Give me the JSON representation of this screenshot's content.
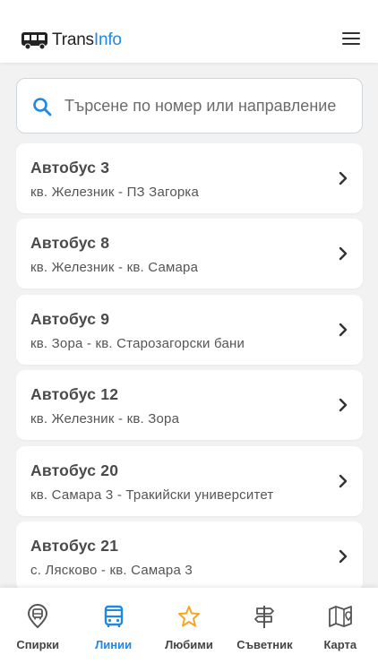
{
  "header": {
    "logo_part1": "Trans",
    "logo_part2": "Info",
    "logo_icon": "bus-icon",
    "menu_icon": "hamburger-menu-icon"
  },
  "search": {
    "placeholder": "Търсене по номер или направление",
    "value": "",
    "icon": "search-icon"
  },
  "lines": [
    {
      "title": "Автобус 3",
      "route": "кв. Железник - ПЗ Загорка"
    },
    {
      "title": "Автобус 8",
      "route": "кв. Железник - кв. Самара"
    },
    {
      "title": "Автобус 9",
      "route": "кв. Зора - кв. Старозагорски бани"
    },
    {
      "title": "Автобус 12",
      "route": "кв. Железник - кв. Зора"
    },
    {
      "title": "Автобус 20",
      "route": "кв. Самара 3 - Тракийски университет"
    },
    {
      "title": "Автобус 21",
      "route": "с. Лясково - кв. Самара 3"
    }
  ],
  "nav": {
    "active": "lines",
    "items": [
      {
        "id": "stops",
        "label": "Спирки",
        "icon": "bus-stop-icon"
      },
      {
        "id": "lines",
        "label": "Линии",
        "icon": "bus-icon"
      },
      {
        "id": "favorites",
        "label": "Любими",
        "icon": "star-icon"
      },
      {
        "id": "advisor",
        "label": "Съветник",
        "icon": "signpost-icon"
      },
      {
        "id": "map",
        "label": "Карта",
        "icon": "map-icon"
      }
    ]
  },
  "colors": {
    "accent": "#1e88e5",
    "favorite": "#f5a623",
    "background": "#f2f2f2",
    "text": "#444444"
  }
}
